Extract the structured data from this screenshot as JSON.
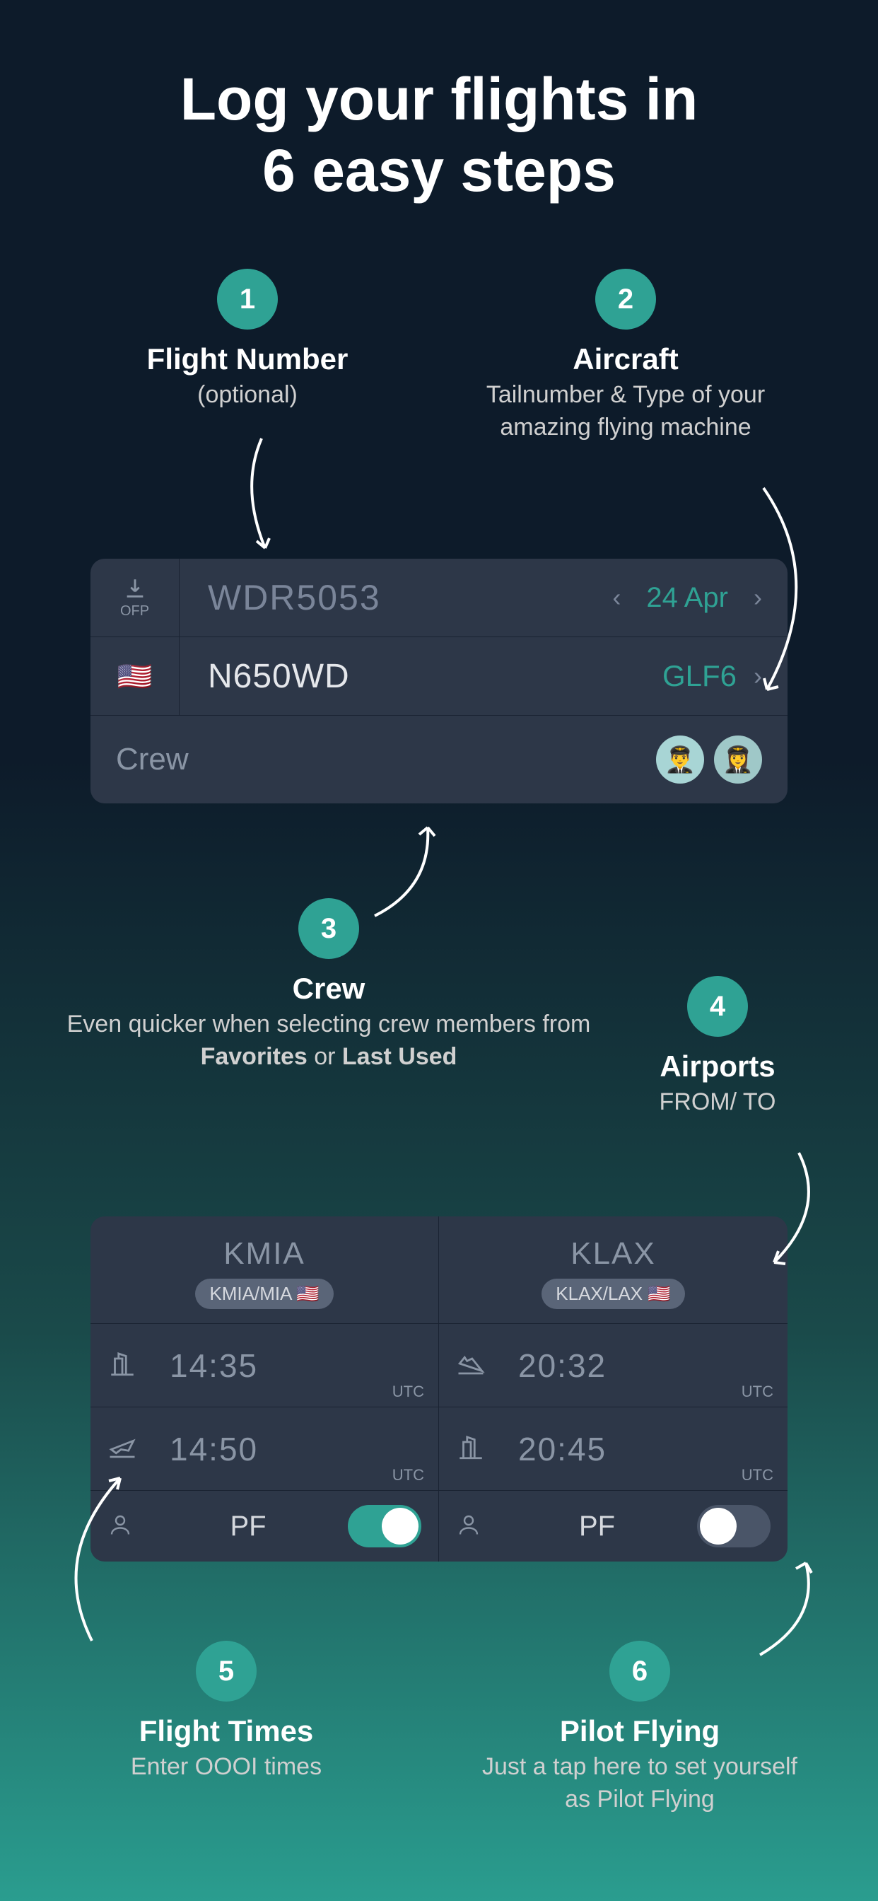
{
  "title_line1": "Log your flights in",
  "title_line2": "6 easy steps",
  "steps": {
    "s1": {
      "num": "1",
      "title": "Flight Number",
      "sub": "(optional)"
    },
    "s2": {
      "num": "2",
      "title": "Aircraft",
      "sub": "Tailnumber & Type of your amazing flying machine"
    },
    "s3": {
      "num": "3",
      "title": "Crew",
      "sub_pre": "Even quicker when selecting crew members from ",
      "sub_b1": "Favorites",
      "sub_mid": " or ",
      "sub_b2": "Last Used"
    },
    "s4": {
      "num": "4",
      "title": "Airports",
      "sub": "FROM/ TO"
    },
    "s5": {
      "num": "5",
      "title": "Flight Times",
      "sub": "Enter OOOI times"
    },
    "s6": {
      "num": "6",
      "title": "Pilot Flying",
      "sub": "Just a tap here to set yourself as Pilot Flying"
    }
  },
  "card1": {
    "ofp_label": "OFP",
    "flight_number": "WDR5053",
    "date": "24 Apr",
    "flag": "🇺🇸",
    "tailnumber": "N650WD",
    "aircraft_type": "GLF6",
    "crew_label": "Crew"
  },
  "card2": {
    "dep": {
      "code": "KMIA",
      "pill": "KMIA/MIA 🇺🇸",
      "out_time": "14:35",
      "off_time": "14:50",
      "tz": "UTC",
      "pf_label": "PF",
      "pf_on": true
    },
    "arr": {
      "code": "KLAX",
      "pill": "KLAX/LAX 🇺🇸",
      "on_time": "20:32",
      "in_time": "20:45",
      "tz": "UTC",
      "pf_label": "PF",
      "pf_on": false
    }
  }
}
